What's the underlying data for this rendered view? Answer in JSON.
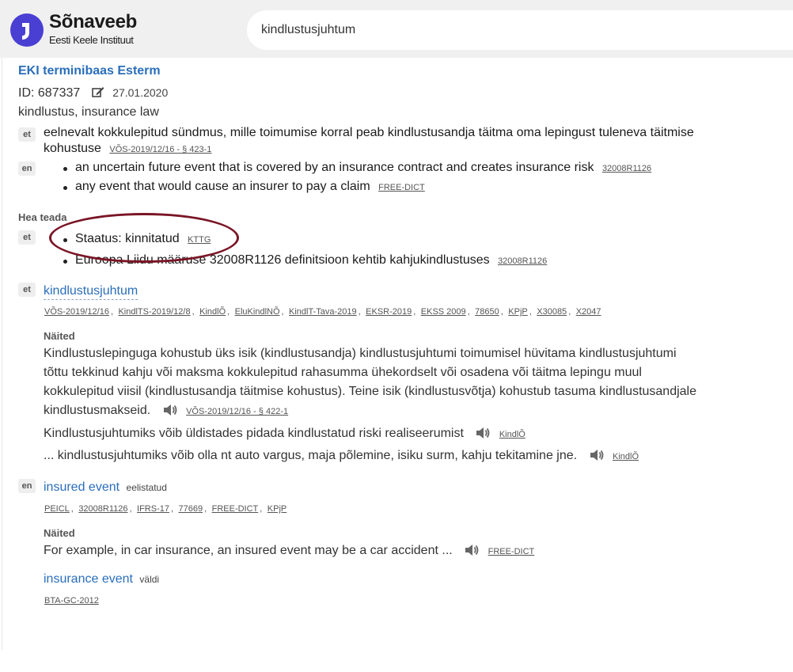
{
  "header": {
    "brand_name": "Sõnaveeb",
    "brand_sub": "Eesti Keele Instituut",
    "search_value": "kindlustusjuhtum"
  },
  "entry": {
    "source_title": "EKI terminibaas Esterm",
    "id_label": "ID: 687337",
    "date": "27.01.2020",
    "domains": "kindlustus,  insurance law",
    "definitions": {
      "et": {
        "lang": "et",
        "text_line1": "eelnevalt kokkulepitud sündmus, mille toimumise korral peab kindlustusandja täitma oma lepingust tuleneva täitmise",
        "text_line2": "kohustuse",
        "source": "VÕS-2019/12/16 - § 423-1"
      },
      "en": {
        "lang": "en",
        "items": [
          {
            "text": "an uncertain future event that is covered by an insurance contract and creates insurance risk",
            "source": "32008R1126"
          },
          {
            "text": "any event that would cause an insurer to pay a claim",
            "source": "FREE-DICT"
          }
        ]
      }
    },
    "notes": {
      "label": "Hea teada",
      "lang": "et",
      "items": [
        {
          "text": "Staatus: kinnitatud",
          "source": "KTTG"
        },
        {
          "text": "Euroopa Liidu määruse 32008R1126 definitsioon kehtib kahjukindlustuses",
          "source": "32008R1126"
        }
      ]
    },
    "et_term": {
      "lang": "et",
      "term": "kindlustusjuhtum",
      "sources": [
        "VÕS-2019/12/16",
        "KindlTS-2019/12/8",
        "KindlÕ",
        "EluKindlNÕ",
        "KindlT-Tava-2019",
        "EKSR-2019",
        "EKSS 2009",
        "78650",
        "KPjP",
        "X30085",
        "X2047"
      ],
      "examples_label": "Näited",
      "examples": [
        {
          "lines": [
            "Kindlustuslepinguga kohustub üks isik (kindlustusandja) kindlustusjuhtumi toimumisel hüvitama kindlustusjuhtumi",
            "tõttu tekkinud kahju või maksma kokkulepitud rahasumma ühekordselt või osadena või täitma lepingu muul",
            "kokkulepitud viisil (kindlustusandja täitmise kohustus). Teine isik (kindlustusvõtja) kohustub tasuma kindlustusandjale",
            "kindlustusmakseid."
          ],
          "source": "VÕS-2019/12/16 - § 422-1"
        },
        {
          "text": "Kindlustusjuhtumiks võib üldistades pidada kindlustatud riski realiseerumist",
          "source": "KindlÕ"
        },
        {
          "text": "... kindlustusjuhtumiks võib olla nt auto vargus, maja põlemine, isiku surm, kahju tekitamine jne.",
          "source": "KindlÕ"
        }
      ]
    },
    "en_terms": {
      "lang": "en",
      "term1": "insured event",
      "term1_tag": "eelistatud",
      "term1_sources": [
        "PEICL",
        "32008R1126",
        "IFRS-17",
        "77669",
        "FREE-DICT",
        "KPjP"
      ],
      "examples_label": "Näited",
      "example_text": "For example, in car insurance, an insured event may be a car accident ...",
      "example_source": "FREE-DICT",
      "term2": "insurance event",
      "term2_tag": "väldi",
      "term2_sources": [
        "BTA-GC-2012"
      ]
    }
  },
  "colors": {
    "link_blue": "#2a6ebb",
    "logo_purple": "#4a3fd3",
    "annotation_oval": "#7a1525"
  }
}
